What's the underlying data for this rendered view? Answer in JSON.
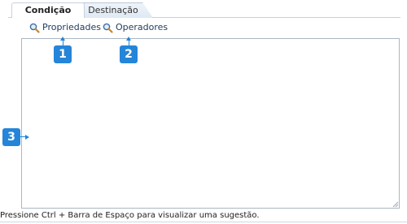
{
  "tabs": [
    {
      "label": "Condição",
      "active": true
    },
    {
      "label": "Destinação",
      "active": false
    }
  ],
  "links": {
    "properties_label": "Propriedades",
    "operators_label": "Operadores"
  },
  "callouts": [
    "1",
    "2",
    "3"
  ],
  "editor": {
    "value": ""
  },
  "hint": "Pressione Ctrl + Barra de Espaço para visualizar uma sugestão.",
  "icons": {
    "links": "magnifier-icon",
    "resize": "resize-grip-icon"
  },
  "colors": {
    "callout": "#2585d8",
    "link": "#1f3a5c",
    "border": "#aab7c4"
  }
}
